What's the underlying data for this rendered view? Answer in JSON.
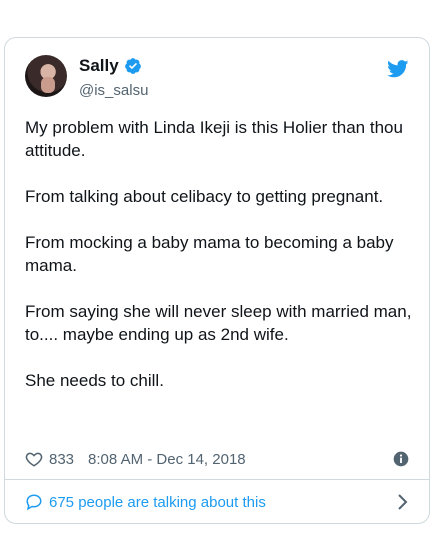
{
  "tweet": {
    "author_name": "Sally",
    "handle": "@is_salsu",
    "paragraphs": [
      "My problem with Linda Ikeji is this Holier than thou attitude.",
      "From talking about celibacy to getting pregnant.",
      "From mocking a baby mama to becoming a baby mama.",
      "From saying she will never sleep with married man, to.... maybe ending up as 2nd wife.",
      "She needs to chill."
    ],
    "likes": "833",
    "timestamp": "8:08 AM - Dec 14, 2018",
    "talking": "675 people are talking about this"
  },
  "icons": {
    "verified": "verified-badge-icon",
    "brand": "twitter-bird-icon",
    "like": "heart-icon",
    "info": "info-icon",
    "reply": "speech-bubble-icon",
    "chevron": "chevron-right-icon"
  },
  "colors": {
    "accent": "#1d9bf0",
    "text": "#0f1419",
    "muted": "#536471",
    "border": "#cfd9de"
  }
}
